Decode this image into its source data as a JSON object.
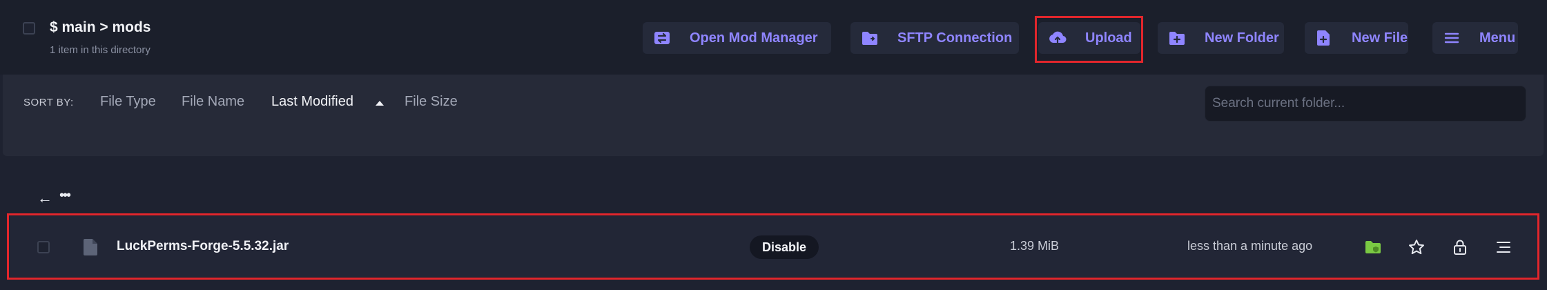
{
  "header": {
    "path": "$ main > mods",
    "item_count": "1 item in this directory"
  },
  "toolbar": {
    "buttons": [
      {
        "label": "Open Mod Manager",
        "icon": "transfer-icon"
      },
      {
        "label": "SFTP Connection",
        "icon": "folder-link-icon"
      },
      {
        "label": "Upload",
        "icon": "cloud-upload-icon"
      },
      {
        "label": "New Folder",
        "icon": "folder-plus-icon"
      },
      {
        "label": "New File",
        "icon": "file-plus-icon"
      },
      {
        "label": "Menu",
        "icon": "hamburger-icon"
      }
    ]
  },
  "sort": {
    "label": "SORT BY:",
    "options": [
      "File Type",
      "File Name",
      "Last Modified",
      "File Size"
    ],
    "active": "Last Modified",
    "direction": "ascending"
  },
  "search": {
    "placeholder": "Search current folder...",
    "value": ""
  },
  "navigation": {
    "back_icon": "arrow-left-icon",
    "more_label": "•••"
  },
  "files": [
    {
      "name": "LuckPerms-Forge-5.5.32.jar",
      "action": "Disable",
      "size": "1.39 MiB",
      "modified": "less than a minute ago",
      "actions": [
        "folder-shield-icon",
        "star-icon",
        "lock-icon",
        "menu-icon"
      ]
    }
  ],
  "colors": {
    "accent": "#8f85ff",
    "highlight": "#e2262c",
    "green": "#7ac943"
  }
}
